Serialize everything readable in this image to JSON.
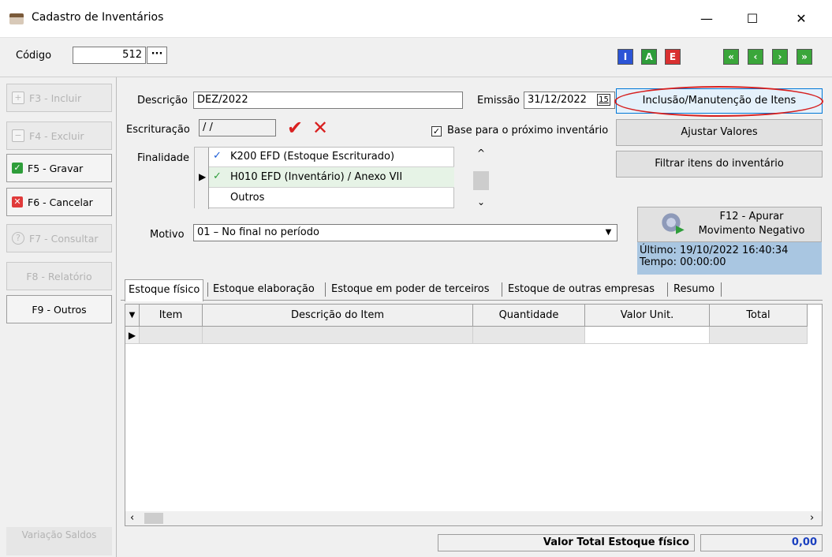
{
  "window": {
    "title": "Cadastro de Inventários",
    "min": "—",
    "max": "☐",
    "close": "✕"
  },
  "toolbar": {
    "codigo_label": "Código",
    "codigo_value": "512",
    "lookup": "···",
    "mode_buttons": [
      {
        "label": "I",
        "color": "#2b54d6"
      },
      {
        "label": "A",
        "color": "#2e9d3a"
      },
      {
        "label": "E",
        "color": "#d93030"
      }
    ],
    "nav_buttons": [
      "«",
      "‹",
      "›",
      "»"
    ]
  },
  "sidebar": {
    "items": [
      {
        "label": "F3 - Incluir",
        "enabled": false,
        "icon": "plus-icon"
      },
      {
        "label": "F4 - Excluir",
        "enabled": false,
        "icon": "minus-icon"
      },
      {
        "label": "F5 - Gravar",
        "enabled": true,
        "icon": "check-icon"
      },
      {
        "label": "F6 - Cancelar",
        "enabled": true,
        "icon": "close-icon"
      },
      {
        "label": "F7 - Consultar",
        "enabled": false,
        "icon": "help-icon"
      },
      {
        "label": "F8 - Relatório",
        "enabled": false,
        "icon": ""
      },
      {
        "label": "F9 - Outros",
        "enabled": true,
        "icon": ""
      }
    ],
    "footer": "Variação Saldos"
  },
  "form": {
    "descricao_label": "Descrição",
    "descricao_value": "DEZ/2022",
    "emissao_label": "Emissão",
    "emissao_value": "31/12/2022",
    "calendar": "15",
    "escrituracao_label": "Escrituração",
    "escrituracao_value": "/ /",
    "base_label": "Base para o próximo inventário",
    "finalidade_label": "Finalidade",
    "finalidade_options": [
      {
        "text": "K200 EFD (Estoque Escriturado)",
        "checked": true,
        "check_color": "#1a5cd6"
      },
      {
        "text": "H010 EFD (Inventário) / Anexo VII",
        "checked": true,
        "check_color": "#2e9d3a"
      },
      {
        "text": "Outros",
        "checked": false
      }
    ],
    "motivo_label": "Motivo",
    "motivo_value": "01 – No final no período"
  },
  "actions": {
    "inclusao": "Inclusão/Manutenção de Itens",
    "ajustar": "Ajustar Valores",
    "filtrar": "Filtrar itens do inventário",
    "apurar_line1": "F12 - Apurar",
    "apurar_line2": "Movimento Negativo",
    "ultimo": "Último: 19/10/2022 16:40:34",
    "tempo": "Tempo: 00:00:00"
  },
  "tabs": [
    "Estoque físico",
    "Estoque elaboração",
    "Estoque em poder de terceiros",
    "Estoque de outras empresas",
    "Resumo"
  ],
  "grid": {
    "columns": [
      "Item",
      "Descrição do Item",
      "Quantidade",
      "Valor Unit.",
      "Total"
    ]
  },
  "footer": {
    "total_label": "Valor Total Estoque físico",
    "total_value": "0,00"
  }
}
